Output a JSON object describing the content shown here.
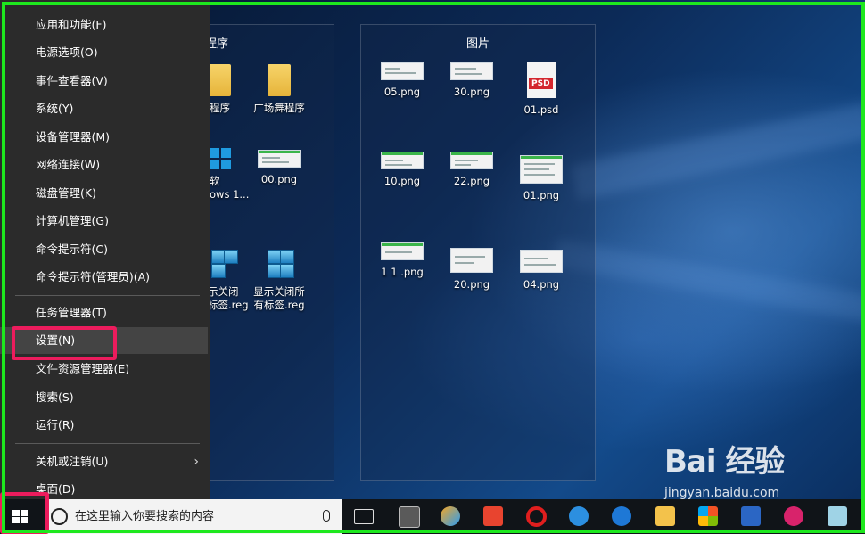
{
  "menu": {
    "items": [
      {
        "label": "应用和功能(F)"
      },
      {
        "label": "电源选项(O)"
      },
      {
        "label": "事件查看器(V)"
      },
      {
        "label": "系统(Y)"
      },
      {
        "label": "设备管理器(M)"
      },
      {
        "label": "网络连接(W)"
      },
      {
        "label": "磁盘管理(K)"
      },
      {
        "label": "计算机管理(G)"
      },
      {
        "label": "命令提示符(C)"
      },
      {
        "label": "命令提示符(管理员)(A)"
      },
      {
        "label": "任务管理器(T)"
      },
      {
        "label": "设置(N)"
      },
      {
        "label": "文件资源管理器(E)"
      },
      {
        "label": "搜索(S)"
      },
      {
        "label": "运行(R)"
      },
      {
        "label": "关机或注销(U)"
      },
      {
        "label": "桌面(D)"
      }
    ],
    "submenu_arrow": "›"
  },
  "desktop": {
    "group1": {
      "title": "程序",
      "icons": [
        {
          "label": "程序",
          "kind": "folder"
        },
        {
          "label": "广场舞程序",
          "kind": "folder"
        },
        {
          "label": "软",
          "label2": "ows 1...",
          "kind": "windows"
        },
        {
          "label": "00.png",
          "kind": "png"
        },
        {
          "label": "示关闭",
          "label2": "标签.reg",
          "kind": "reg"
        },
        {
          "label": "显示关闭所",
          "label2": "有标签.reg",
          "kind": "reg"
        }
      ]
    },
    "group2": {
      "title": "图片",
      "icons": [
        {
          "label": "05.png"
        },
        {
          "label": "30.png"
        },
        {
          "label": "01.psd",
          "badge": "PSD"
        },
        {
          "label": "10.png"
        },
        {
          "label": "22.png"
        },
        {
          "label": "01.png"
        },
        {
          "label": "1 1 .png"
        },
        {
          "label": "20.png"
        },
        {
          "label": "04.png"
        }
      ]
    }
  },
  "taskbar": {
    "search_placeholder": "在这里输入你要搜索的内容",
    "icons": [
      "calculator-icon",
      "ie-arch-icon",
      "power-icon",
      "ban-icon",
      "browser-icon",
      "edge-icon",
      "file-explorer-icon",
      "store-icon",
      "word-icon",
      "app-icon",
      "notes-icon"
    ]
  },
  "watermark": {
    "big": "Bai 经验",
    "small": "jingyan.baidu.com"
  },
  "colors": {
    "menu_bg": "#2b2b2b",
    "highlight_red": "#ec1c5d",
    "frame_green": "#1ee81e",
    "taskbar_bg": "#101418"
  }
}
